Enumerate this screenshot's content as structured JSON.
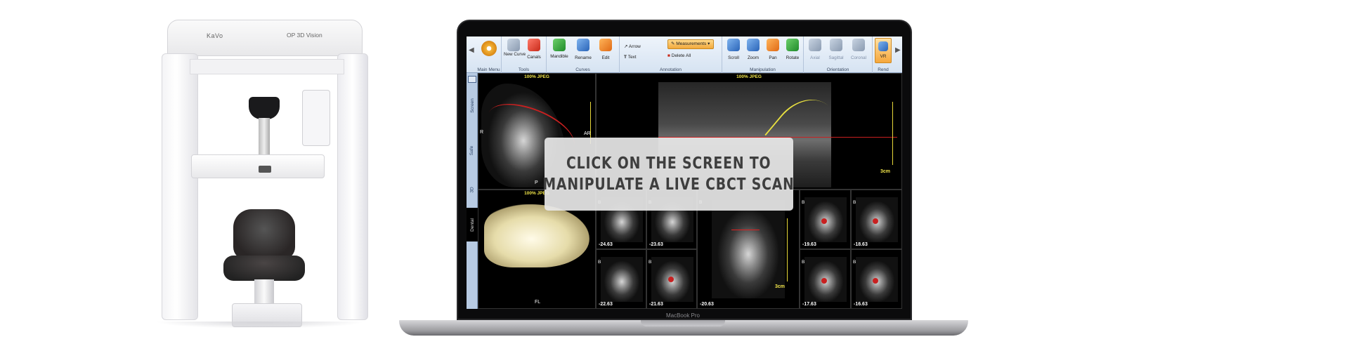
{
  "machine": {
    "brand": "KaVo",
    "model": "OP 3D Vision"
  },
  "laptop": {
    "label": "MacBook Pro"
  },
  "ribbon": {
    "main_menu_group": "Main Menu",
    "tools_group": "Tools",
    "curves_group": "Curves",
    "annotation_group": "Annotation",
    "manipulation_group": "Manipulation",
    "orientation_group": "Orientation",
    "render_group": "Rend",
    "new_curve": "New Curve",
    "canals": "Canals",
    "mandible": "Mandible",
    "rename": "Rename",
    "edit": "Edit",
    "arrow": "Arrow",
    "text": "Text",
    "measurements": "Measurements",
    "delete_all": "Delete All",
    "scroll": "Scroll",
    "zoom": "Zoom",
    "pan": "Pan",
    "rotate": "Rotate",
    "axial": "Axial",
    "sagittal": "Sagittal",
    "coronal": "Coronal",
    "vr": "VR"
  },
  "side_tabs": [
    "Screen",
    "Safe",
    "3D",
    "Dental"
  ],
  "viewports": {
    "axial_label": "100% JPEG",
    "pano_label": "100% JPEG",
    "render_label": "100% JPEG",
    "marker_r": "R",
    "marker_p": "P",
    "marker_ar": "AR",
    "marker_fl": "FL",
    "scale_label": "3cm",
    "scale_label_2": "3cm"
  },
  "slices": [
    {
      "b": "B",
      "value": "-24.63"
    },
    {
      "b": "B",
      "value": "-23.63"
    },
    {
      "b": "B",
      "value": "-22.63"
    },
    {
      "b": "B",
      "value": "-21.63"
    },
    {
      "b": "B",
      "value": "-20.63"
    },
    {
      "b": "B",
      "value": "-19.63"
    },
    {
      "b": "B",
      "value": "-18.63"
    },
    {
      "b": "B",
      "value": "-17.63"
    },
    {
      "b": "B",
      "value": "-16.63"
    }
  ],
  "overlay": {
    "line1": "CLICK ON THE SCREEN TO",
    "line2": "MANIPULATE A LIVE CBCT SCAN"
  }
}
